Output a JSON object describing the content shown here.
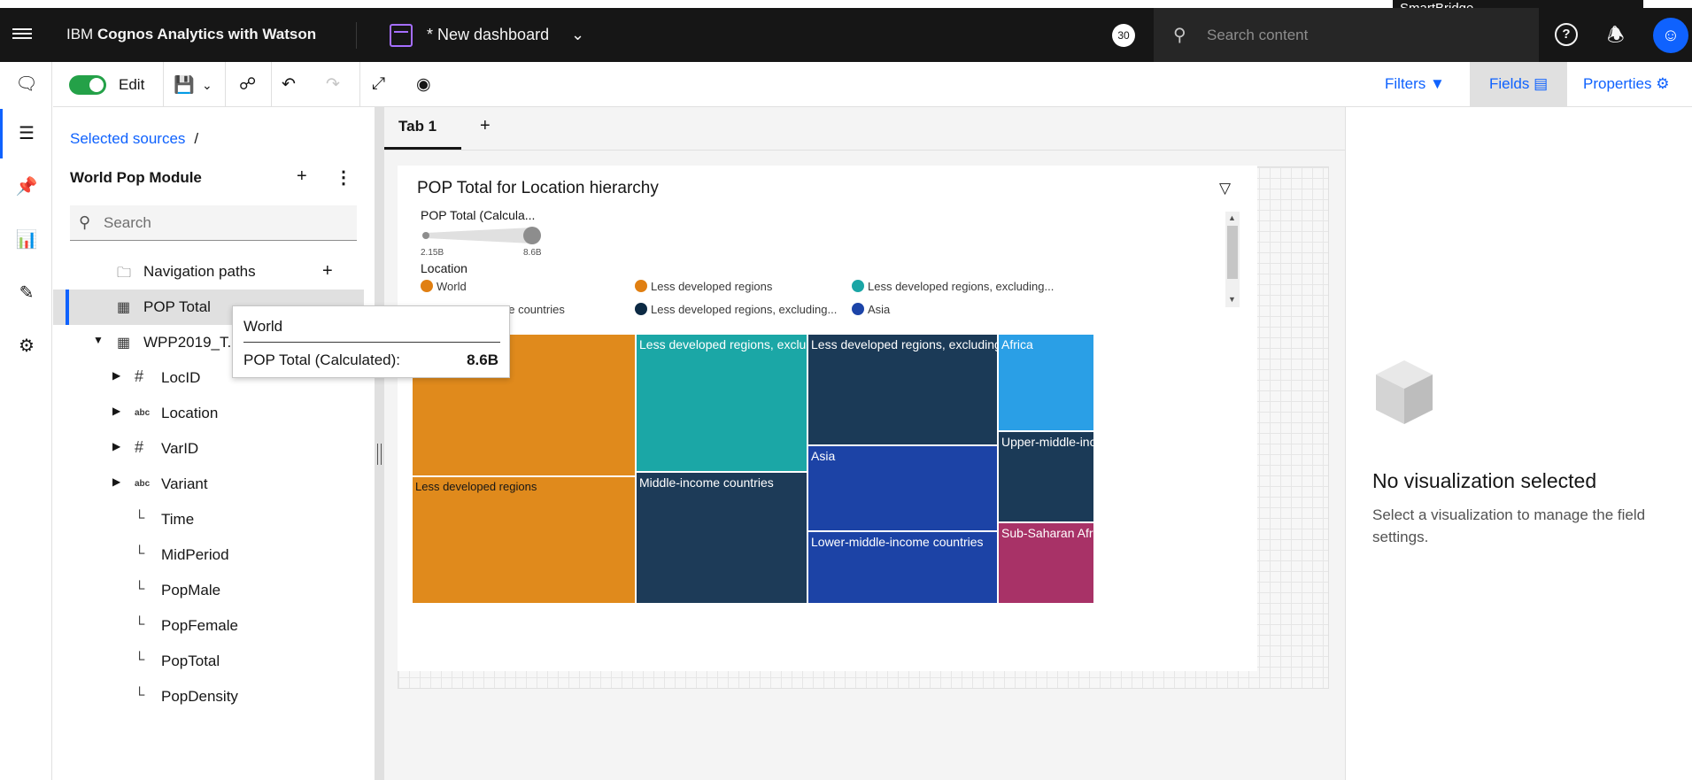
{
  "header": {
    "app_name_prefix": "IBM",
    "app_name": "Cognos Analytics with Watson",
    "dashboard_title": "* New dashboard",
    "badge": "30",
    "search_placeholder": "Search content",
    "tooltip": "SmartBridge"
  },
  "toolbar": {
    "edit_label": "Edit",
    "filters_label": "Filters",
    "fields_label": "Fields",
    "properties_label": "Properties"
  },
  "sources": {
    "breadcrumb": "Selected sources",
    "breadcrumb_sep": "/",
    "module": "World Pop Module",
    "search_placeholder": "Search",
    "items": [
      {
        "label": "Navigation paths"
      },
      {
        "label": "POP Total"
      },
      {
        "label": "WPP2019_T..."
      },
      {
        "label": "LocID"
      },
      {
        "label": "Location"
      },
      {
        "label": "VarID"
      },
      {
        "label": "Variant"
      },
      {
        "label": "Time"
      },
      {
        "label": "MidPeriod"
      },
      {
        "label": "PopMale"
      },
      {
        "label": "PopFemale"
      },
      {
        "label": "PopTotal"
      },
      {
        "label": "PopDensity"
      }
    ]
  },
  "canvas": {
    "tab_label": "Tab 1",
    "tab_add": "+"
  },
  "widget": {
    "title": "POP Total for Location hierarchy",
    "size_legend_label": "POP Total (Calcula...",
    "size_min": "2.15B",
    "size_max": "8.6B",
    "color_legend_label": "Location",
    "legend_items": [
      {
        "label": "World",
        "color": "#e07f12"
      },
      {
        "label": "Less developed regions",
        "color": "#e07f12"
      },
      {
        "label": "Less developed regions, excluding...",
        "color": "#1aa5a5"
      },
      {
        "label": "ne countries",
        "color": "#1a3a56"
      },
      {
        "label": "Less developed regions, excluding...",
        "color": "#0c2a44"
      },
      {
        "label": "Asia",
        "color": "#1c44a8"
      }
    ]
  },
  "chart_data": {
    "type": "treemap",
    "title": "POP Total for Location hierarchy",
    "size_measure": "POP Total (Calculated)",
    "size_range": [
      "2.15B",
      "8.6B"
    ],
    "cells": [
      {
        "label": "",
        "color": "#e08a1c"
      },
      {
        "label": "Less developed regions",
        "color": "#e08a1c"
      },
      {
        "label": "Less developed regions, excluding C...",
        "color": "#1ba7a6"
      },
      {
        "label": "Middle-income countries",
        "color": "#1d3b58"
      },
      {
        "label": "Less developed regions, excluding least ...",
        "color": "#1b3a57"
      },
      {
        "label": "Asia",
        "color": "#1c43a6"
      },
      {
        "label": "Lower-middle-income countries",
        "color": "#1c43a6"
      },
      {
        "label": "Africa",
        "color": "#2a9fe6"
      },
      {
        "label": "Upper-middle-inco...",
        "color": "#1b3a57"
      },
      {
        "label": "Sub-Saharan Africa",
        "color": "#a83267"
      }
    ]
  },
  "hover_tooltip": {
    "title": "World",
    "measure_label": "POP Total (Calculated):",
    "measure_value": "8.6B"
  },
  "right_panel": {
    "title": "No visualization selected",
    "subtitle": "Select a visualization to manage the field settings."
  }
}
